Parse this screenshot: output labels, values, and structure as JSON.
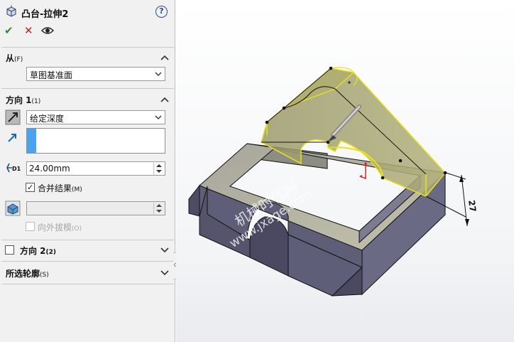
{
  "feature": {
    "title": "凸台-拉伸2",
    "help_symbol": "?"
  },
  "actions": {
    "ok_symbol": "✔",
    "cancel_symbol": "✕"
  },
  "from_section": {
    "title": "从",
    "shortcut": "(F)",
    "start_condition": "草图基准面"
  },
  "direction1": {
    "title": "方向 1",
    "shortcut": "(1)",
    "end_condition": "给定深度",
    "depth": "24.00mm",
    "merge_checked": true,
    "merge_label": "合并结果",
    "merge_shortcut": "(M)",
    "draft_angle": "",
    "draft_outward_checked": false,
    "draft_outward_label": "向外拔模",
    "draft_outward_shortcut": "(O)",
    "depth_icon_label": "D1",
    "check_symbol": "✓"
  },
  "direction2": {
    "title": "方向 2",
    "shortcut": "(2)",
    "checked": false
  },
  "selected_contours": {
    "title": "所选轮廓",
    "shortcut": "(S)"
  },
  "viewport": {
    "dimension_value": "27",
    "watermark_cn": "机械时代网",
    "watermark_url": "www.jxage.com"
  },
  "colors": {
    "confirm": "#2e8b2e",
    "cancel": "#d41a1a",
    "selection_blue": "#4aa3f0",
    "preview_yellow": "#e8e21c",
    "part_body": "#5f5e78"
  }
}
